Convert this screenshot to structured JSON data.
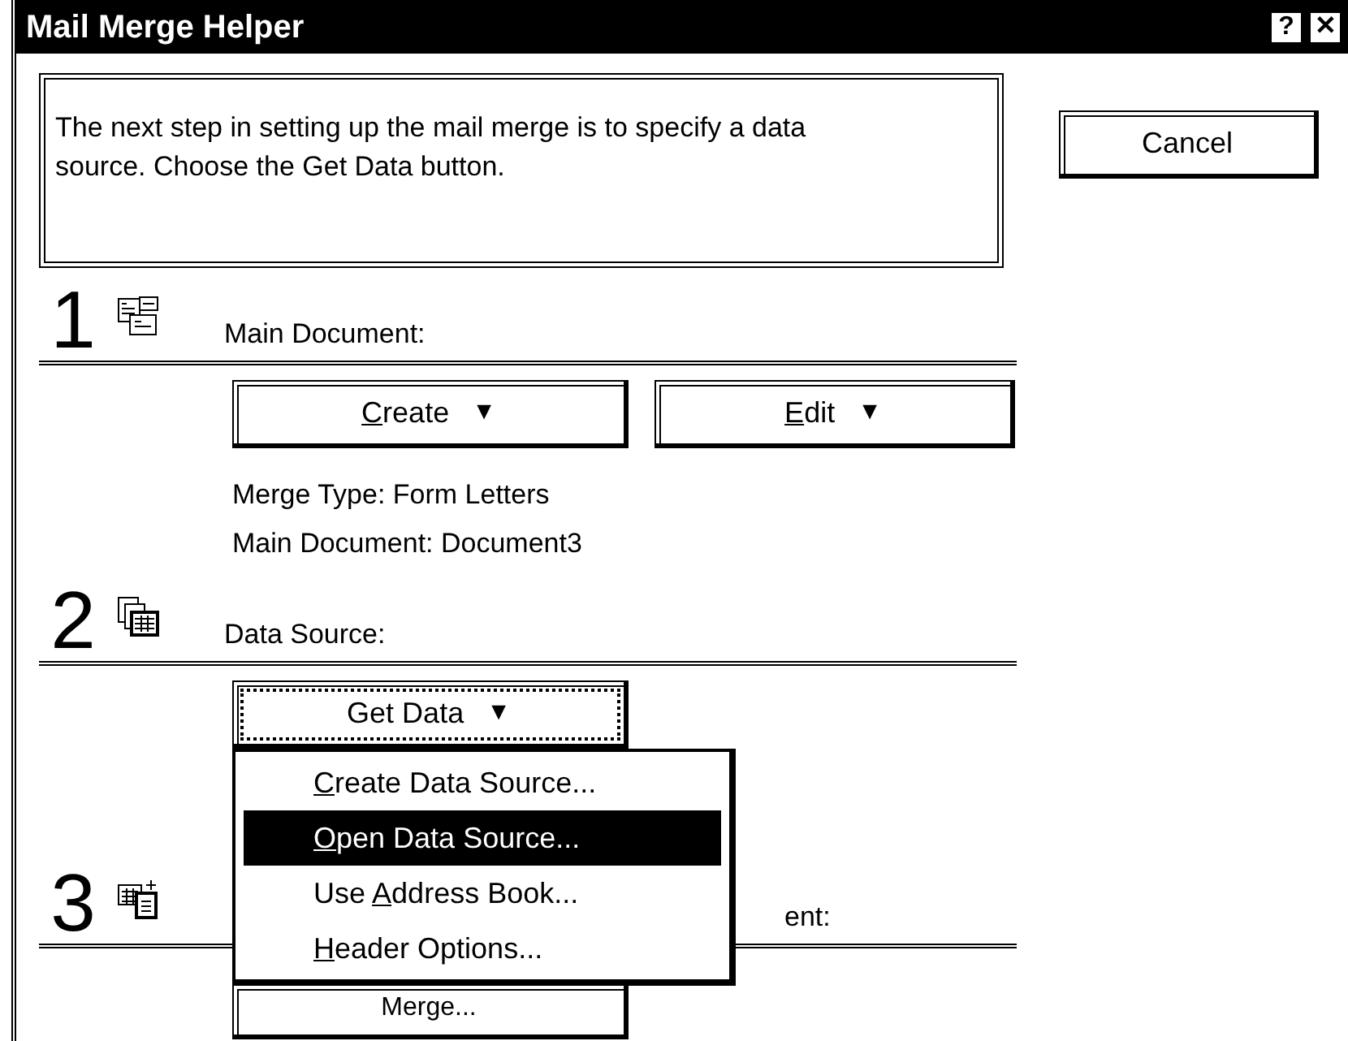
{
  "window": {
    "title": "Mail Merge Helper",
    "title_buttons": [
      "?",
      "✕"
    ]
  },
  "message": "The next step in setting up the mail merge is to specify a data source. Choose the Get Data button.",
  "cancel_button": "Cancel",
  "steps": [
    {
      "number": "1",
      "kind": "main",
      "label": "Main Document:",
      "buttons": [
        {
          "key": "C",
          "after": "reate",
          "arrow": "▼",
          "focused": false
        },
        {
          "key": "E",
          "after": "dit",
          "arrow": "▼",
          "focused": false
        }
      ],
      "info": [
        "Merge Type: Form Letters",
        "Main Document: Document3"
      ]
    },
    {
      "number": "2",
      "kind": "data",
      "label": "Data Source:",
      "buttons": [
        {
          "before": "Get Data",
          "arrow": "▼",
          "focused": true
        }
      ],
      "menu": [
        {
          "key": "C",
          "after": "reate Data Source...",
          "selected": false
        },
        {
          "key": "O",
          "after": "pen Data Source...",
          "selected": true
        },
        {
          "before": "Use ",
          "key": "A",
          "after": "ddress Book...",
          "selected": false
        },
        {
          "key": "H",
          "after": "eader Options...",
          "selected": false
        }
      ]
    },
    {
      "number": "3",
      "kind": "merge",
      "label": "ent:",
      "buttons": [
        {
          "before": "Merge..."
        }
      ]
    }
  ]
}
